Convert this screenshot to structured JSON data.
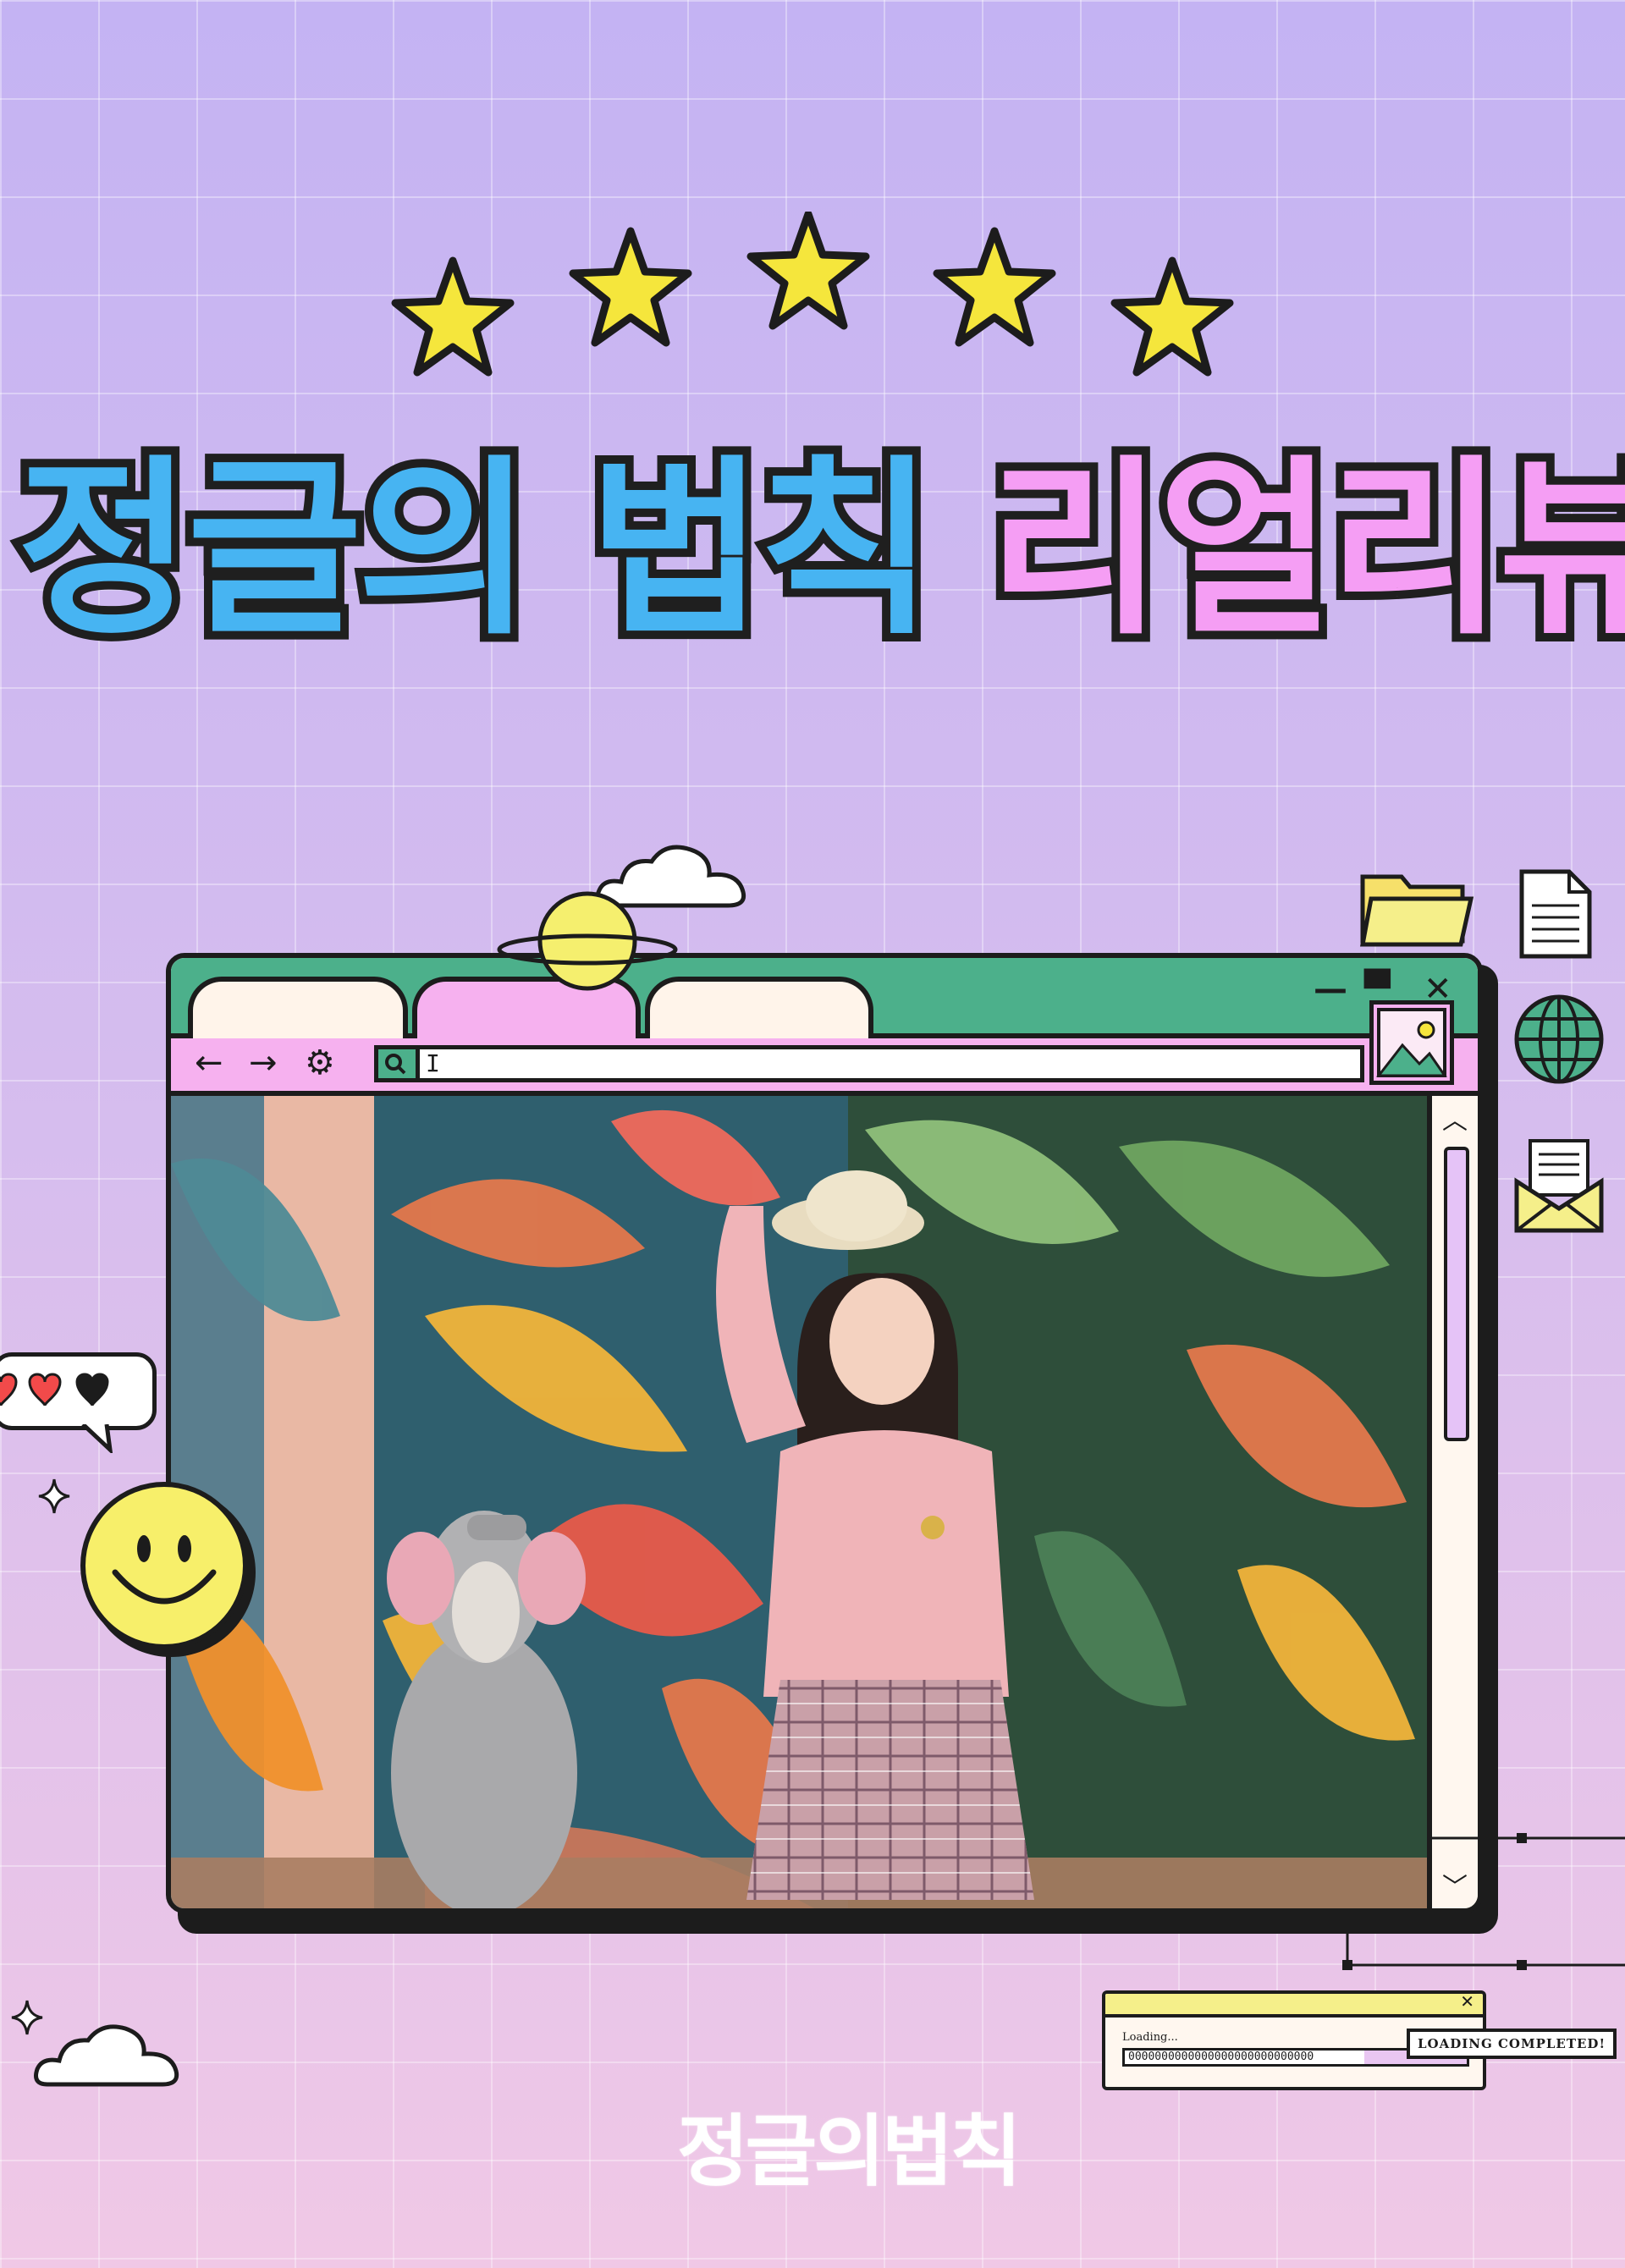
{
  "header": {
    "rating_stars": 5,
    "title_part1": "정글의 법칙",
    "title_part2": "리얼리뷰"
  },
  "browser": {
    "window_controls": {
      "minimize": "—",
      "maximize": "▀",
      "close": "✕"
    },
    "nav": {
      "back": "←",
      "forward": "→",
      "settings": "⚙"
    },
    "address_value": "I",
    "scroll_up": "︿",
    "scroll_down": "﹀"
  },
  "loading_dialog": {
    "close": "✕",
    "label": "Loading...",
    "progress_text": "0000000000000000000000000000",
    "progress_fraction": 0.7,
    "completed_label": "LOADING COMPLETED!"
  },
  "footer": {
    "logo_text": "정글의법칙"
  },
  "colors": {
    "title_blue": "#47b4f2",
    "title_pink": "#f59ef4",
    "star_yellow": "#f5e63c",
    "browser_green": "#4cb08b",
    "browser_pink": "#f6b1ef",
    "outline": "#1c1c1c"
  },
  "icons": [
    "star-icon",
    "cloud-icon",
    "planet-icon",
    "folder-icon",
    "document-icon",
    "globe-icon",
    "envelope-icon",
    "smiley-icon",
    "heart-icon",
    "sparkle-icon",
    "image-icon"
  ]
}
